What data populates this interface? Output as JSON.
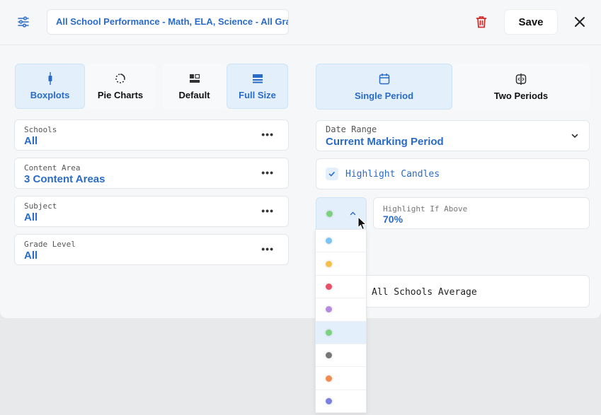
{
  "header": {
    "title": "All School Performance - Math, ELA, Science - All Grades",
    "save_label": "Save"
  },
  "view_modes": [
    {
      "label": "Boxplots",
      "icon": "boxplot-icon",
      "active": true
    },
    {
      "label": "Pie Charts",
      "icon": "pie-chart-icon",
      "active": false
    }
  ],
  "size_modes": [
    {
      "label": "Default",
      "icon": "default-layout-icon",
      "active": false
    },
    {
      "label": "Full Size",
      "icon": "full-size-icon",
      "active": true
    }
  ],
  "period_modes": [
    {
      "label": "Single Period",
      "icon": "calendar-icon",
      "active": true
    },
    {
      "label": "Two Periods",
      "icon": "compare-icon",
      "active": false
    }
  ],
  "filters": [
    {
      "label": "Schools",
      "value": "All"
    },
    {
      "label": "Content Area",
      "value": "3 Content Areas"
    },
    {
      "label": "Subject",
      "value": "All"
    },
    {
      "label": "Grade Level",
      "value": "All"
    }
  ],
  "date_range": {
    "label": "Date Range",
    "value": "Current Marking Period"
  },
  "highlight_candles": {
    "label": "Highlight Candles",
    "checked": true
  },
  "highlight_if_above": {
    "label": "Highlight If Above",
    "value": "70%"
  },
  "average_line": {
    "label": "All Schools Average"
  },
  "color_picker": {
    "selected": "#7bd17f",
    "options": [
      "#7cc4f5",
      "#f5c04a",
      "#e8506a",
      "#b48be0",
      "#7bd17f",
      "#777777",
      "#f08a4e",
      "#7b7fe0"
    ],
    "selected_index": 4
  },
  "colors": {
    "accent": "#2a6bc7",
    "danger": "#d0312d"
  }
}
